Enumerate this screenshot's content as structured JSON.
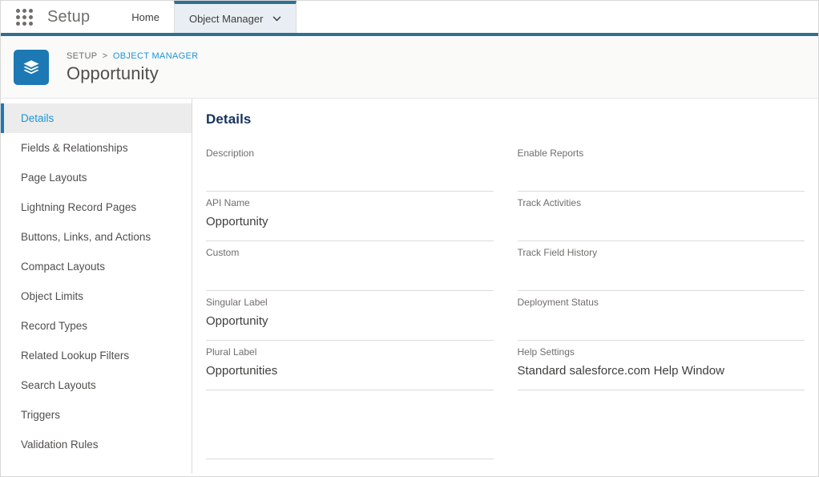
{
  "global_nav": {
    "app_launcher_icon": "app-launcher-waffle-icon",
    "setup_label": "Setup",
    "tabs": [
      {
        "label": "Home",
        "active": false,
        "has_chevron": false
      },
      {
        "label": "Object Manager",
        "active": true,
        "has_chevron": true,
        "chevron_icon": "chevron-down-icon"
      }
    ]
  },
  "page_header": {
    "object_icon": "stacked-layers-icon",
    "breadcrumb": {
      "root": "SETUP",
      "separator": ">",
      "current_link": "OBJECT MANAGER"
    },
    "title": "Opportunity"
  },
  "sidebar": {
    "items": [
      {
        "label": "Details",
        "selected": true
      },
      {
        "label": "Fields & Relationships",
        "selected": false
      },
      {
        "label": "Page Layouts",
        "selected": false
      },
      {
        "label": "Lightning Record Pages",
        "selected": false
      },
      {
        "label": "Buttons, Links, and Actions",
        "selected": false
      },
      {
        "label": "Compact Layouts",
        "selected": false
      },
      {
        "label": "Object Limits",
        "selected": false
      },
      {
        "label": "Record Types",
        "selected": false
      },
      {
        "label": "Related Lookup Filters",
        "selected": false
      },
      {
        "label": "Search Layouts",
        "selected": false
      },
      {
        "label": "Triggers",
        "selected": false
      },
      {
        "label": "Validation Rules",
        "selected": false
      }
    ]
  },
  "main": {
    "section_title": "Details",
    "left_column": [
      {
        "label": "Description",
        "value": ""
      },
      {
        "label": "API Name",
        "value": "Opportunity"
      },
      {
        "label": "Custom",
        "value": ""
      },
      {
        "label": "Singular Label",
        "value": "Opportunity"
      },
      {
        "label": "Plural Label",
        "value": "Opportunities"
      },
      {
        "label": "",
        "value": ""
      }
    ],
    "right_column": [
      {
        "label": "Enable Reports",
        "value": ""
      },
      {
        "label": "Track Activities",
        "value": ""
      },
      {
        "label": "Track Field History",
        "value": ""
      },
      {
        "label": "Deployment Status",
        "value": ""
      },
      {
        "label": "Help Settings",
        "value": "Standard salesforce.com Help Window"
      }
    ]
  },
  "colors": {
    "brand_blue": "#1c79b4",
    "nav_accent": "#316f91",
    "link_blue": "#1b96d6",
    "header_bg": "#fafaf9",
    "selected_item_bg": "#ececec",
    "rule": "#dddbda",
    "label_gray": "#706e6b",
    "value_gray": "#3e3e3c",
    "active_tab_bg": "#e8eef3"
  }
}
